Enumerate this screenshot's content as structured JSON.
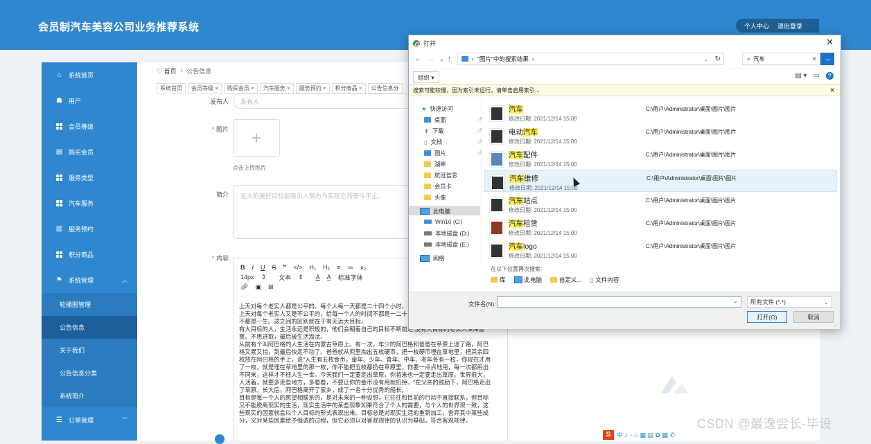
{
  "app": {
    "title": "会员制汽车美容公司业务推荐系统",
    "user_menu": [
      "个人中心",
      "退出登录"
    ]
  },
  "sidebar": {
    "items": [
      {
        "label": "系统首页",
        "icon": "home-icon"
      },
      {
        "label": "用户",
        "icon": "user-icon"
      },
      {
        "label": "会员等级",
        "icon": "grid-icon"
      },
      {
        "label": "购买会员",
        "icon": "doc-icon"
      },
      {
        "label": "服务类型",
        "icon": "grid-icon"
      },
      {
        "label": "汽车服务",
        "icon": "grid-icon"
      },
      {
        "label": "服务预约",
        "icon": "chart-icon"
      },
      {
        "label": "积分商品",
        "icon": "grid-icon"
      },
      {
        "label": "系统管理",
        "icon": "flag-icon"
      }
    ],
    "sub_items": [
      "轮播图管理",
      "公告信息",
      "关于我们",
      "公告信息分类",
      "系统简介"
    ],
    "active_sub": "公告信息",
    "last_item": {
      "label": "订单管理",
      "icon": "order-icon"
    }
  },
  "breadcrumb": {
    "home": "首页",
    "current": "公告信息"
  },
  "tags": [
    "系统首页",
    "会员等级",
    "购买会员",
    "汽车服务",
    "服务预约",
    "积分商品",
    "公告信息分"
  ],
  "form": {
    "publisher_label": "发布人",
    "publisher_placeholder": "发布人",
    "image_label": "图片",
    "upload_hint": "点击上传图片",
    "intro_label": "简介",
    "intro_placeholder": "远大的美好目标能吸引人努力为实现它而奋斗不止。",
    "content_label": "内容"
  },
  "editor": {
    "toolbar_row1": [
      "B",
      "I",
      "U",
      "S",
      "❞",
      "</>",
      "H₁",
      "H₂",
      "≡",
      "≔",
      "x₂"
    ],
    "toolbar_row2": [
      "14px",
      "⇕",
      "文本",
      "⇕",
      "A",
      "A̲",
      "标准字体"
    ],
    "paragraphs": [
      "上天对每个老实人都是公平的。每个人每一天都是二十四个小时，",
      "上天对每个老实人又是不公平的，给每一个人的时间不都是一二十",
      "不都是一生。这之间的区别就在于有无远大目标。",
      "有大目标的人，生活永远是积极的，他们会朝着自己的目标不断前进;没有大目标的老实人浑浑噩",
      "噩、不思进取，最后被生活淘汰。",
      "从前有个叫阿巴格的人生活在内蒙古草原上。有一次，年少的阿巴格和爸爸在草原上迷了路，阿巴",
      "格又累又怕，到最后快走不动了。爸爸就从兜里掏出五枚硬币，把一枚硬币埋在草地里，把其余四",
      "枚放在阿巴格的手上，说\"人生有五枚金币，童年、少年、青年、中年、老年各有一枚，你现在才用",
      "了一枚，就是埋在草地里的那一枚，你不能把五枚都扔在草原里，你要一点点地用，每一次都用出",
      "不同来，这样才不枉人生一世。今天我们一定要走出草原，你将来也一定要走出草原。世界很大，",
      "人活着，就要多走些地方，多看看，不要让你的金币没有用就扔掉。\"在父亲的鼓励下，阿巴格走出",
      "了草原。长大后，阿巴格离开了家乡，成了一名十分优秀的船长。",
      "目标是每一个人的愿望相联系的，是对未来的一种设想，它往往和目前的行动不直接联系。但目标",
      "又不能脱离现实的生活，现实生活中的某些现象如果符合了个人的需要，与个人的世界观一致，这",
      "些现实的因素就会以个人目标的形式表现出来。目标总是对现实生活的重新加工，舍弃其中某些成",
      "分，又对某些因素给予强调的过程，但它必须以对客观规律的认识为基础，符合客观规律。"
    ]
  },
  "dialog": {
    "title": "打开",
    "address": [
      "\"图片\"中的搜索结果",
      "›"
    ],
    "search_value": "汽车",
    "organize_label": "组织 ▾",
    "info_bar": "搜索可能较慢，因为索引未运行。请单击启用索引...",
    "tree": {
      "quick_access": "快速访问",
      "pinned": [
        "桌面",
        "下载",
        "文档",
        "图片"
      ],
      "folders": [
        "湖畔",
        "航班信息",
        "会员卡",
        "头像"
      ],
      "this_pc": "此电脑",
      "drives": [
        "Win10 (C:)",
        "本地磁盘 (D:)",
        "本地磁盘 (E:)"
      ],
      "network": "网络"
    },
    "files": [
      {
        "prefix": "汽车",
        "suffix": "",
        "date": "修改日期: 2021/12/14 15:09",
        "path": "C:\\用户\\Administrator\\桌面\\图片\\图片"
      },
      {
        "prefix": "电动",
        "hl": "汽车",
        "suffix": "",
        "date": "修改日期: 2021/12/14 15:00",
        "path": "C:\\用户\\Administrator\\桌面\\图片\\图片"
      },
      {
        "prefix": "汽车",
        "suffix": "配件",
        "date": "修改日期: 2021/12/14 15:00",
        "path": "C:\\用户\\Administrator\\桌面\\图片\\图片"
      },
      {
        "prefix": "汽车",
        "suffix": "维修",
        "date": "修改日期: 2021/12/14 15:00",
        "path": "C:\\用户\\Administrator\\桌面\\图片\\图片"
      },
      {
        "prefix": "汽车",
        "suffix": "站点",
        "date": "修改日期: 2021/12/14 15:00",
        "path": "C:\\用户\\Administrator\\桌面\\图片\\图片"
      },
      {
        "prefix": "汽车",
        "suffix": "租赁",
        "date": "修改日期: 2021/12/14 15:00",
        "path": "C:\\用户\\Administrator\\桌面\\图片\\图片"
      },
      {
        "prefix": "汽车",
        "suffix": "logo",
        "date": "修改日期: 2021/12/14 15:00",
        "path": "C:\\用户\\Administrator\\桌面\\图片\\图片"
      }
    ],
    "search_again_label": "在以下位置再次搜索:",
    "search_again": [
      "库",
      "此电脑",
      "自定义...",
      "文件内容"
    ],
    "filename_label": "文件名(N):",
    "filename_value": "",
    "filetype_value": "所有文件 (*.*)",
    "open_label": "打开(O)",
    "cancel_label": "取消"
  },
  "watermark": "CSDN @最逸尝长-毕设",
  "colors": {
    "primary": "#2f87cf",
    "primary_dark": "#1c5f9b",
    "highlight": "#ffef5a"
  }
}
